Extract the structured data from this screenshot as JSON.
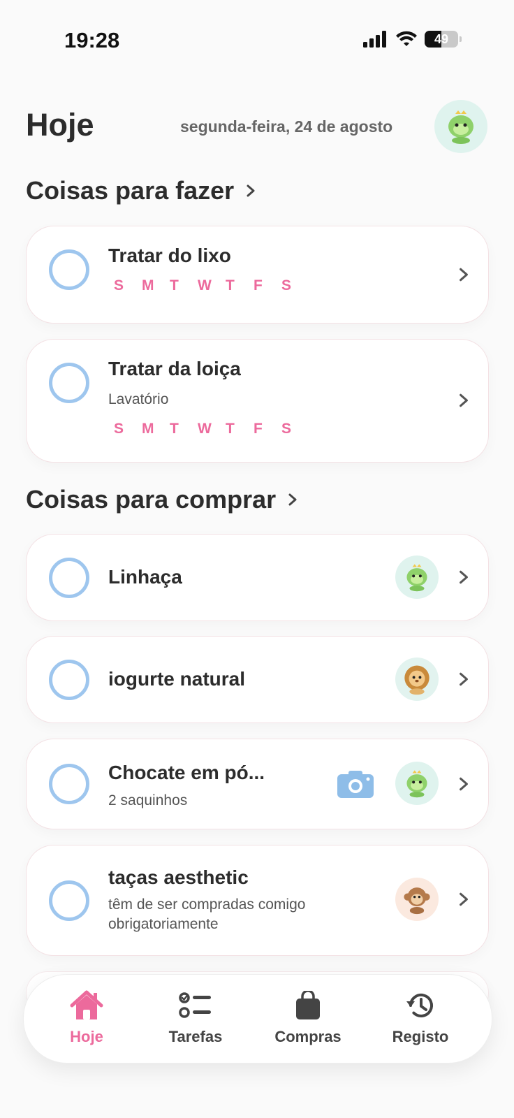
{
  "status_bar": {
    "time": "19:28",
    "battery": "49"
  },
  "header": {
    "title": "Hoje",
    "date": "segunda-feira, 24 de agosto",
    "avatar_icon": "dino-avatar-icon"
  },
  "sections": {
    "todo": {
      "title": "Coisas para fazer"
    },
    "shopping": {
      "title": "Coisas para comprar"
    }
  },
  "tasks": [
    {
      "title": "Tratar do lixo",
      "days": [
        "S",
        "M",
        "T",
        "W",
        "T",
        "F",
        "S"
      ]
    },
    {
      "title": "Tratar da loiça",
      "subtitle": "Lavatório",
      "days": [
        "S",
        "M",
        "T",
        "W",
        "T",
        "F",
        "S"
      ]
    }
  ],
  "shopping_items": [
    {
      "title": "Linhaça",
      "avatar": "dino-avatar-icon"
    },
    {
      "title": "iogurte natural",
      "avatar": "lion-avatar-icon"
    },
    {
      "title": "Chocate em pó...",
      "subtitle": "2 saquinhos",
      "avatar": "dino-avatar-icon",
      "attachment": "camera-icon"
    },
    {
      "title": "taças aesthetic",
      "subtitle_line1": "têm de ser compradas comigo",
      "subtitle_line2": "obrigatoriamente",
      "avatar": "monkey-avatar-icon"
    }
  ],
  "tabbar": {
    "tabs": [
      {
        "label": "Hoje",
        "icon": "home-icon",
        "active": true
      },
      {
        "label": "Tarefas",
        "icon": "checklist-icon"
      },
      {
        "label": "Compras",
        "icon": "shopping-bag-icon"
      },
      {
        "label": "Registo",
        "icon": "history-icon"
      }
    ]
  },
  "colors": {
    "accent": "#ec6a9c",
    "circle": "#9ec6ee",
    "text": "#2c2c2c"
  }
}
